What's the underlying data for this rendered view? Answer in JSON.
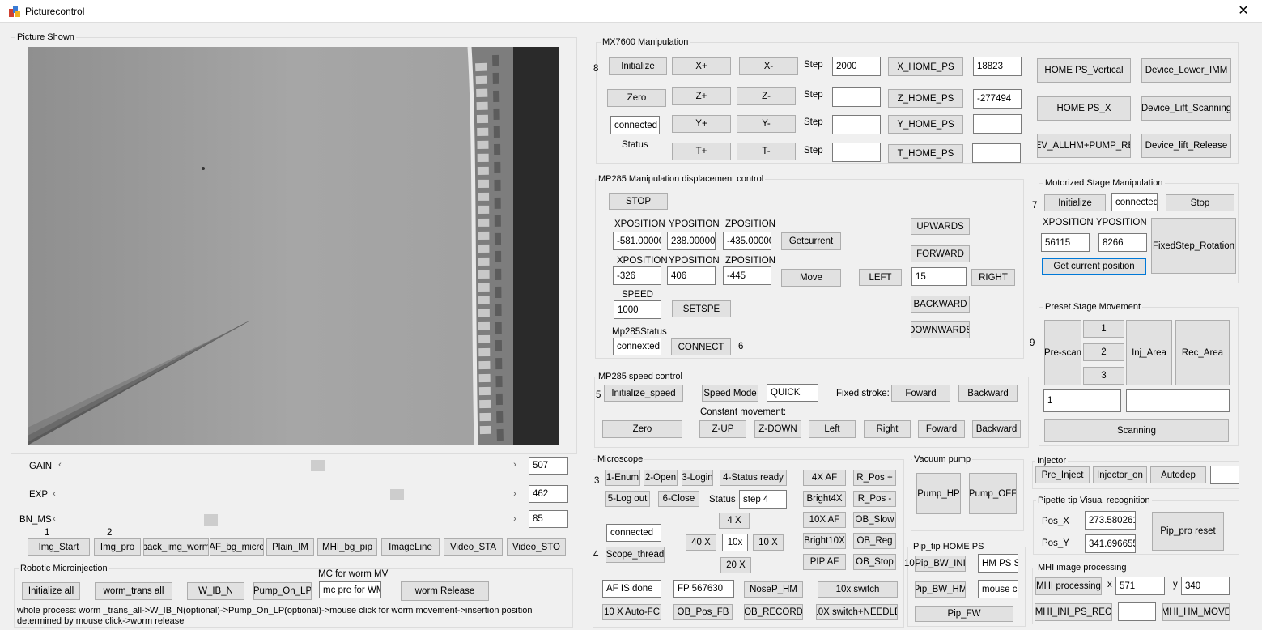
{
  "window": {
    "title": "Picturecontrol"
  },
  "picture": {
    "group": "Picture Shown"
  },
  "sliders": {
    "gain": {
      "label": "GAIN",
      "value": "507",
      "fraction": 0.57
    },
    "exp": {
      "label": "EXP",
      "value": "462",
      "fraction": 0.76
    },
    "bn": {
      "label": "BN_MS",
      "value": "85",
      "fraction": 0.33
    }
  },
  "img_buttons": {
    "n1": "1",
    "n2": "2",
    "img_start": "Img_Start",
    "img_pro": "Img_pro",
    "back_img_worm": "back_img_worm",
    "af_bg_micro": "AF_bg_micro",
    "plain_im": "Plain_IM",
    "mhi_bg_pip": "MHI_bg_pip",
    "imageline": "ImageLine",
    "video_sta": "Video_STA",
    "video_sto": "Video_STO"
  },
  "robotic": {
    "group": "Robotic Microinjection",
    "initialize_all": "Initialize all",
    "worm_trans_all": "worm_trans all",
    "w_ib_n": "W_IB_N",
    "pump_on_lp": "Pump_On_LP",
    "mc_label": "MC for worm MV",
    "mc_input": "mc pre for WM",
    "worm_release": "worm Release",
    "desc": "whole process: worm _trans_all->W_IB_N(optional)->Pump_On_LP(optional)->mouse click for worm movement->insertion position determined by mouse click->worm release"
  },
  "mx7600": {
    "group": "MX7600 Manipulation",
    "num": "8",
    "initialize": "Initialize",
    "xp": "X+",
    "xm": "X-",
    "zero": "Zero",
    "zp": "Z+",
    "zm": "Z-",
    "status_box": "connected",
    "yp": "Y+",
    "ym": "Y-",
    "status_lbl": "Status",
    "tp": "T+",
    "tm": "T-",
    "step": "Step",
    "step_x": "2000",
    "step_z": "",
    "step_y": "",
    "step_t": "",
    "x_home": "X_HOME_PS",
    "z_home": "Z_HOME_PS",
    "y_home": "Y_HOME_PS",
    "t_home": "T_HOME_PS",
    "x_home_val": "18823",
    "z_home_val": "-277494",
    "y_home_val": "",
    "t_home_val": "",
    "home_vertical": "HOME PS_Vertical",
    "home_x": "HOME PS_X",
    "dev_allhm": "DEV_ALLHM+PUMP_REL",
    "dev_lower": "Device_Lower_IMM",
    "dev_lift_scan": "Device_Lift_Scanning",
    "dev_lift_rel": "Device_lift_Release"
  },
  "mp285": {
    "group": "MP285 Manipulation displacement control",
    "stop": "STOP",
    "xpos": "XPOSITION",
    "ypos": "YPOSITION",
    "zpos": "ZPOSITION",
    "x_cur": "-581.00000",
    "y_cur": "238.000000",
    "z_cur": "-435.00000",
    "getcurrent": "Getcurrent",
    "x_tgt": "-326",
    "y_tgt": "406",
    "z_tgt": "-445",
    "move": "Move",
    "speed_lbl": "SPEED",
    "speed": "1000",
    "setspe": "SETSPE",
    "status_lbl": "Mp285Status",
    "status": "connexted",
    "connect": "CONNECT",
    "num": "6",
    "upwards": "UPWARDS",
    "forward": "FORWARD",
    "left": "LEFT",
    "step": "15",
    "right": "RIGHT",
    "backward": "BACKWARD",
    "downwards": "DOWNWARDS"
  },
  "speed": {
    "group": "MP285 speed control",
    "num": "5",
    "init": "Initialize_speed",
    "mode_btn": "Speed Mode",
    "mode": "QUICK",
    "fixed": "Fixed stroke:",
    "foward": "Foward",
    "backward": "Backward",
    "constant": "Constant movement:",
    "zero": "Zero",
    "zup": "Z-UP",
    "zdown": "Z-DOWN",
    "left": "Left",
    "right": "Right",
    "foward2": "Foward",
    "backward2": "Backward"
  },
  "stage": {
    "group": "Motorized Stage Manipulation",
    "num": "7",
    "init": "Initialize",
    "status": "connected",
    "stop": "Stop",
    "xpos": "XPOSITION",
    "ypos": "YPOSITION",
    "x": "56115",
    "y": "8266",
    "fixed": "FixedStep_Rotation",
    "getcur": "Get current position"
  },
  "preset": {
    "group": "Preset Stage Movement",
    "num": "9",
    "prescan": "Pre-scan",
    "b1": "1",
    "b2": "2",
    "b3": "3",
    "inj": "Inj_Area",
    "rec": "Rec_Area",
    "input1": "1",
    "input2": "",
    "scanning": "Scanning"
  },
  "microscope": {
    "group": "Microscope",
    "num3": "3",
    "num4": "4",
    "enum": "1-Enum",
    "open": "2-Open",
    "login": "3-Login",
    "ready": "4-Status ready",
    "logout": "5-Log out",
    "close": "6-Close",
    "status_lbl": "Status",
    "status": "step 4",
    "x4": "4 X",
    "x40": "40 X",
    "x10sel": "10x",
    "x10": "10 X",
    "x20": "20 X",
    "connected": "connected",
    "scope_thread": "Scope_thread",
    "af4x": "4X AF",
    "bright4x": "Bright4X",
    "af10x": "10X AF",
    "bright10x": "Bright10X",
    "pipaf": "PIP AF",
    "rposp": "R_Pos +",
    "rposm": "R_Pos -",
    "obslow": "OB_Slow",
    "obreg": "OB_Reg",
    "obstop": "OB_Stop",
    "afdone": "AF IS done",
    "fp": "FP 567630",
    "nosep": "NoseP_HM",
    "switch10": "10x switch",
    "autofc": "10 X Auto-FC",
    "obposfb": "OB_Pos_FB",
    "obrecord": "OB_RECORD",
    "switchneedle": "10X switch+NEEDLE"
  },
  "vacuum": {
    "group": "Vacuum pump",
    "hp": "Pump_HP",
    "off": "Pump_OFF"
  },
  "piptip": {
    "group": "Pip_tip HOME PS",
    "num": "10",
    "bwini": "Pip_BW_INI",
    "hm_ps": "HM PS SE",
    "bwhm": "Pip_BW_HM",
    "mouse": "mouse cl",
    "fw": "Pip_FW"
  },
  "injector": {
    "group": "Injector",
    "pre": "Pre_Inject",
    "on": "Injector_on",
    "autodep": "Autodep",
    "val": ""
  },
  "pipette": {
    "group": "Pipette tip Visual recognition",
    "posx_lbl": "Pos_X",
    "posx": "273.580261",
    "posy_lbl": "Pos_Y",
    "posy": "341.696655",
    "reset": "Pip_pro reset"
  },
  "mhi": {
    "group": "MHI image processing",
    "proc": "MHI processing",
    "x_lbl": "x",
    "x": "571",
    "y_lbl": "y",
    "y": "340",
    "ini": "MHI_INI_PS_REC",
    "val": "",
    "move": "MHI_HM_MOVE"
  }
}
